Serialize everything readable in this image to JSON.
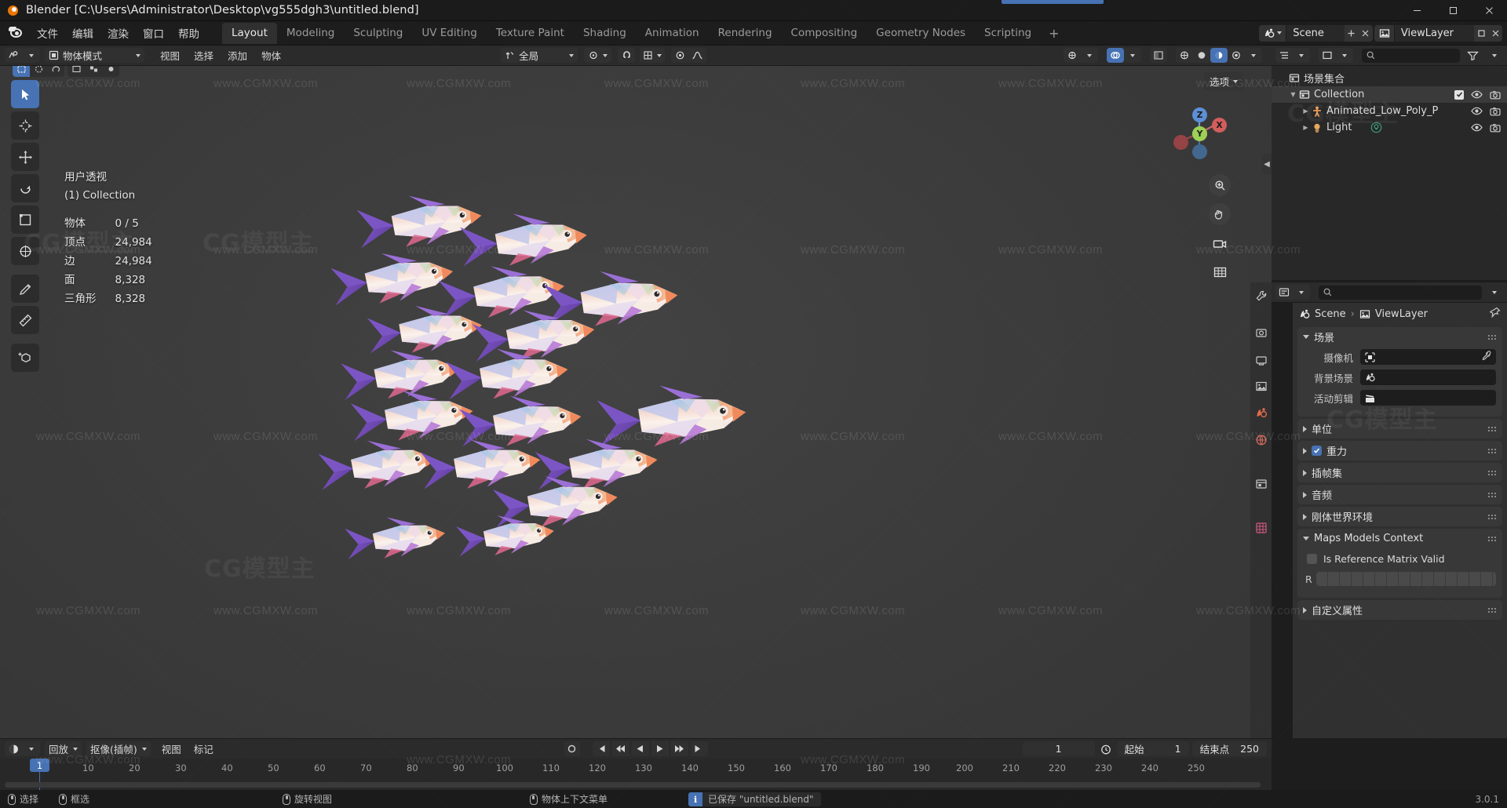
{
  "window": {
    "title": "Blender [C:\\Users\\Administrator\\Desktop\\vg555dgh3\\untitled.blend]",
    "minimize": "minimize-icon",
    "maximize": "maximize-icon",
    "close": "close-icon"
  },
  "topbar": {
    "menus": [
      "文件",
      "编辑",
      "渲染",
      "窗口",
      "帮助"
    ],
    "workspaces": [
      {
        "label": "Layout",
        "active": true
      },
      {
        "label": "Modeling",
        "active": false
      },
      {
        "label": "Sculpting",
        "active": false
      },
      {
        "label": "UV Editing",
        "active": false
      },
      {
        "label": "Texture Paint",
        "active": false
      },
      {
        "label": "Shading",
        "active": false
      },
      {
        "label": "Animation",
        "active": false
      },
      {
        "label": "Rendering",
        "active": false
      },
      {
        "label": "Compositing",
        "active": false
      },
      {
        "label": "Geometry Nodes",
        "active": false
      },
      {
        "label": "Scripting",
        "active": false
      }
    ],
    "add_workspace": "+",
    "scene_name": "Scene",
    "viewlayer_name": "ViewLayer"
  },
  "viewport_header": {
    "mode": "物体模式",
    "menus": [
      "视图",
      "选择",
      "添加",
      "物体"
    ],
    "transform_orientation": "全局",
    "options_label": "选项"
  },
  "viewport": {
    "stats": {
      "view_name": "用户透视",
      "collection": "(1) Collection",
      "rows": [
        {
          "label": "物体",
          "value": "0 / 5"
        },
        {
          "label": "顶点",
          "value": "24,984"
        },
        {
          "label": "边",
          "value": "24,984"
        },
        {
          "label": "面",
          "value": "8,328"
        },
        {
          "label": "三角形",
          "value": "8,328"
        }
      ]
    },
    "gizmo_axes": [
      "Z",
      "Y",
      "X"
    ],
    "tools": [
      "tweak-tool",
      "cursor-tool",
      "move-tool",
      "rotate-tool",
      "scale-tool",
      "transform-tool",
      "annotate-tool",
      "measure-tool",
      "add-cube-tool"
    ],
    "nav_buttons": [
      "zoom-icon",
      "pan-icon",
      "camera-icon",
      "ortho-toggle-icon"
    ]
  },
  "outliner": {
    "search_placeholder": "",
    "rows": [
      {
        "name": "场景集合",
        "depth": 0,
        "icon": "collection-icon",
        "arrow": "",
        "selected": false,
        "checkbox": false,
        "eye": false,
        "camera": false
      },
      {
        "name": "Collection",
        "depth": 1,
        "icon": "collection-icon",
        "arrow": "down",
        "selected": true,
        "checkbox": true,
        "eye": true,
        "camera": true
      },
      {
        "name": "Animated_Low_Poly_P",
        "depth": 2,
        "icon": "armature-icon",
        "arrow": "right",
        "selected": false,
        "checkbox": false,
        "eye": true,
        "camera": true
      },
      {
        "name": "Light",
        "depth": 2,
        "icon": "light-icon",
        "arrow": "right",
        "selected": false,
        "checkbox": false,
        "eye": true,
        "camera": true
      }
    ]
  },
  "properties": {
    "breadcrumb": [
      "Scene",
      "ViewLayer"
    ],
    "tabs": [
      "tool-tab",
      "render-tab",
      "output-tab",
      "viewlayer-tab",
      "scene-tab",
      "world-tab",
      "collection-tab",
      "texture-tab"
    ],
    "panels": [
      {
        "title": "场景",
        "open": true,
        "fields": [
          {
            "label": "摄像机",
            "value": "",
            "icon": "camera-data-icon",
            "eyedropper": true
          },
          {
            "label": "背景场景",
            "value": "",
            "icon": "scene-icon",
            "eyedropper": false
          },
          {
            "label": "活动剪辑",
            "value": "",
            "icon": "clip-icon",
            "eyedropper": false
          }
        ]
      },
      {
        "title": "单位",
        "open": false,
        "fields": []
      },
      {
        "title": "重力",
        "open": false,
        "checkbox": true,
        "fields": []
      },
      {
        "title": "插帧集",
        "open": false,
        "fields": []
      },
      {
        "title": "音频",
        "open": false,
        "fields": []
      },
      {
        "title": "刚体世界环境",
        "open": false,
        "fields": []
      },
      {
        "title": "Maps Models Context",
        "open": true,
        "checkbox_row": {
          "label": "Is Reference Matrix Valid",
          "checked": false
        },
        "array_row": {
          "label": "R"
        }
      },
      {
        "title": "自定义属性",
        "open": false,
        "fields": []
      }
    ]
  },
  "timeline": {
    "editor_type": "timeline-icon",
    "menus": [
      "回放",
      "抠像(插帧)",
      "视图",
      "标记"
    ],
    "playback_label": "回放",
    "keying_label": "抠像(插帧)",
    "view_label": "视图",
    "marker_label": "标记",
    "transport": [
      "jump-start-icon",
      "prev-keyframe-icon",
      "play-reverse-icon",
      "play-icon",
      "next-keyframe-icon",
      "jump-end-icon"
    ],
    "record_button": "record-icon",
    "current_frame": "1",
    "start_label": "起始",
    "start_value": "1",
    "end_label": "结束点",
    "end_value": "250",
    "ticks": [
      "1",
      "10",
      "20",
      "30",
      "40",
      "50",
      "60",
      "70",
      "80",
      "90",
      "100",
      "110",
      "120",
      "130",
      "140",
      "150",
      "160",
      "170",
      "180",
      "190",
      "200",
      "210",
      "220",
      "230",
      "240",
      "250"
    ],
    "playhead_frame": "1"
  },
  "statusbar": {
    "hints": [
      {
        "mouse": "left",
        "label": "选择"
      },
      {
        "mouse": "left-drag",
        "label": "框选"
      },
      {
        "mouse": "middle",
        "label": "旋转视图"
      },
      {
        "mouse": "right",
        "label": "物体上下文菜单"
      }
    ],
    "saved_message": "已保存 \"untitled.blend\"",
    "version": "3.0.1"
  },
  "watermark": {
    "small": "www.CGMXW.com",
    "big": "CG模型主"
  },
  "colors": {
    "accent": "#4772b3",
    "bg_dark": "#1d1d1d",
    "bg_panel": "#303030",
    "bg_viewport": "#3b3b3b",
    "text": "#d5d5d5"
  }
}
